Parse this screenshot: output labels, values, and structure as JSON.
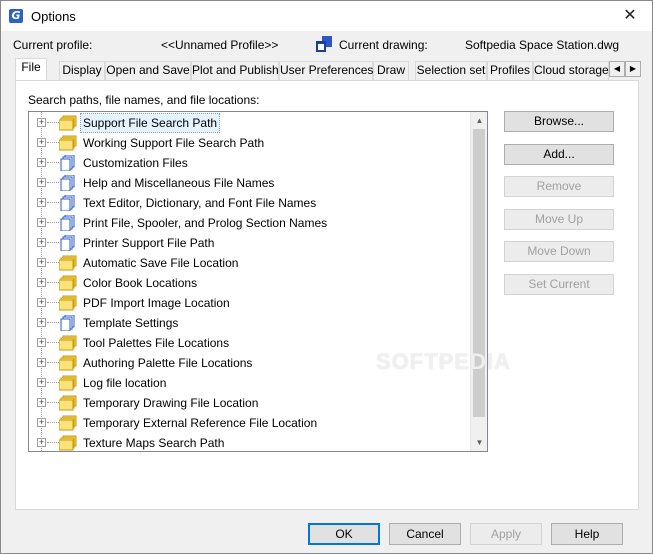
{
  "window": {
    "title": "Options",
    "close_glyph": "✕"
  },
  "profile": {
    "current_profile_label": "Current profile:",
    "current_profile_value": "<<Unnamed Profile>>",
    "current_drawing_label": "Current drawing:",
    "current_drawing_value": "Softpedia Space Station.dwg"
  },
  "tabs": [
    {
      "label": "File",
      "active": true
    },
    {
      "label": "Display"
    },
    {
      "label": "Open and Save"
    },
    {
      "label": "Plot and Publish"
    },
    {
      "label": "User Preferences"
    },
    {
      "label": "Draw"
    },
    {
      "label": "Selection set"
    },
    {
      "label": "Profiles"
    },
    {
      "label": "Cloud storage"
    }
  ],
  "panel": {
    "label": "Search paths, file names, and file locations:",
    "tree": [
      {
        "label": "Support File Search Path",
        "icon": "folder-stack-icon",
        "selected": true
      },
      {
        "label": "Working Support File Search Path",
        "icon": "folder-stack-icon"
      },
      {
        "label": "Customization Files",
        "icon": "document-stack-icon"
      },
      {
        "label": "Help and Miscellaneous File Names",
        "icon": "document-stack-icon"
      },
      {
        "label": "Text Editor, Dictionary, and Font File Names",
        "icon": "document-stack-icon"
      },
      {
        "label": "Print File, Spooler, and Prolog Section Names",
        "icon": "document-stack-icon"
      },
      {
        "label": "Printer Support File Path",
        "icon": "document-stack-icon"
      },
      {
        "label": "Automatic Save File Location",
        "icon": "folder-stack-icon"
      },
      {
        "label": "Color Book Locations",
        "icon": "folder-stack-icon"
      },
      {
        "label": "PDF Import Image Location",
        "icon": "folder-stack-icon"
      },
      {
        "label": "Template Settings",
        "icon": "document-stack-icon"
      },
      {
        "label": "Tool Palettes File Locations",
        "icon": "folder-stack-icon"
      },
      {
        "label": "Authoring Palette File Locations",
        "icon": "folder-stack-icon"
      },
      {
        "label": "Log file location",
        "icon": "folder-stack-icon"
      },
      {
        "label": "Temporary Drawing File Location",
        "icon": "folder-stack-icon"
      },
      {
        "label": "Temporary External Reference File Location",
        "icon": "folder-stack-icon"
      },
      {
        "label": "Texture Maps Search Path",
        "icon": "folder-stack-icon"
      }
    ]
  },
  "side_buttons": {
    "browse": "Browse...",
    "add": "Add...",
    "remove": "Remove",
    "move_up": "Move Up",
    "move_down": "Move Down",
    "set_current": "Set Current"
  },
  "bottom_buttons": {
    "ok": "OK",
    "cancel": "Cancel",
    "apply": "Apply",
    "help": "Help"
  },
  "watermark": "SOFTPEDIA",
  "colors": {
    "selection": "#e5f3ff",
    "folder": "#f7d54a",
    "document_blue": "#2b58c9",
    "default_button_border": "#0078d7"
  }
}
